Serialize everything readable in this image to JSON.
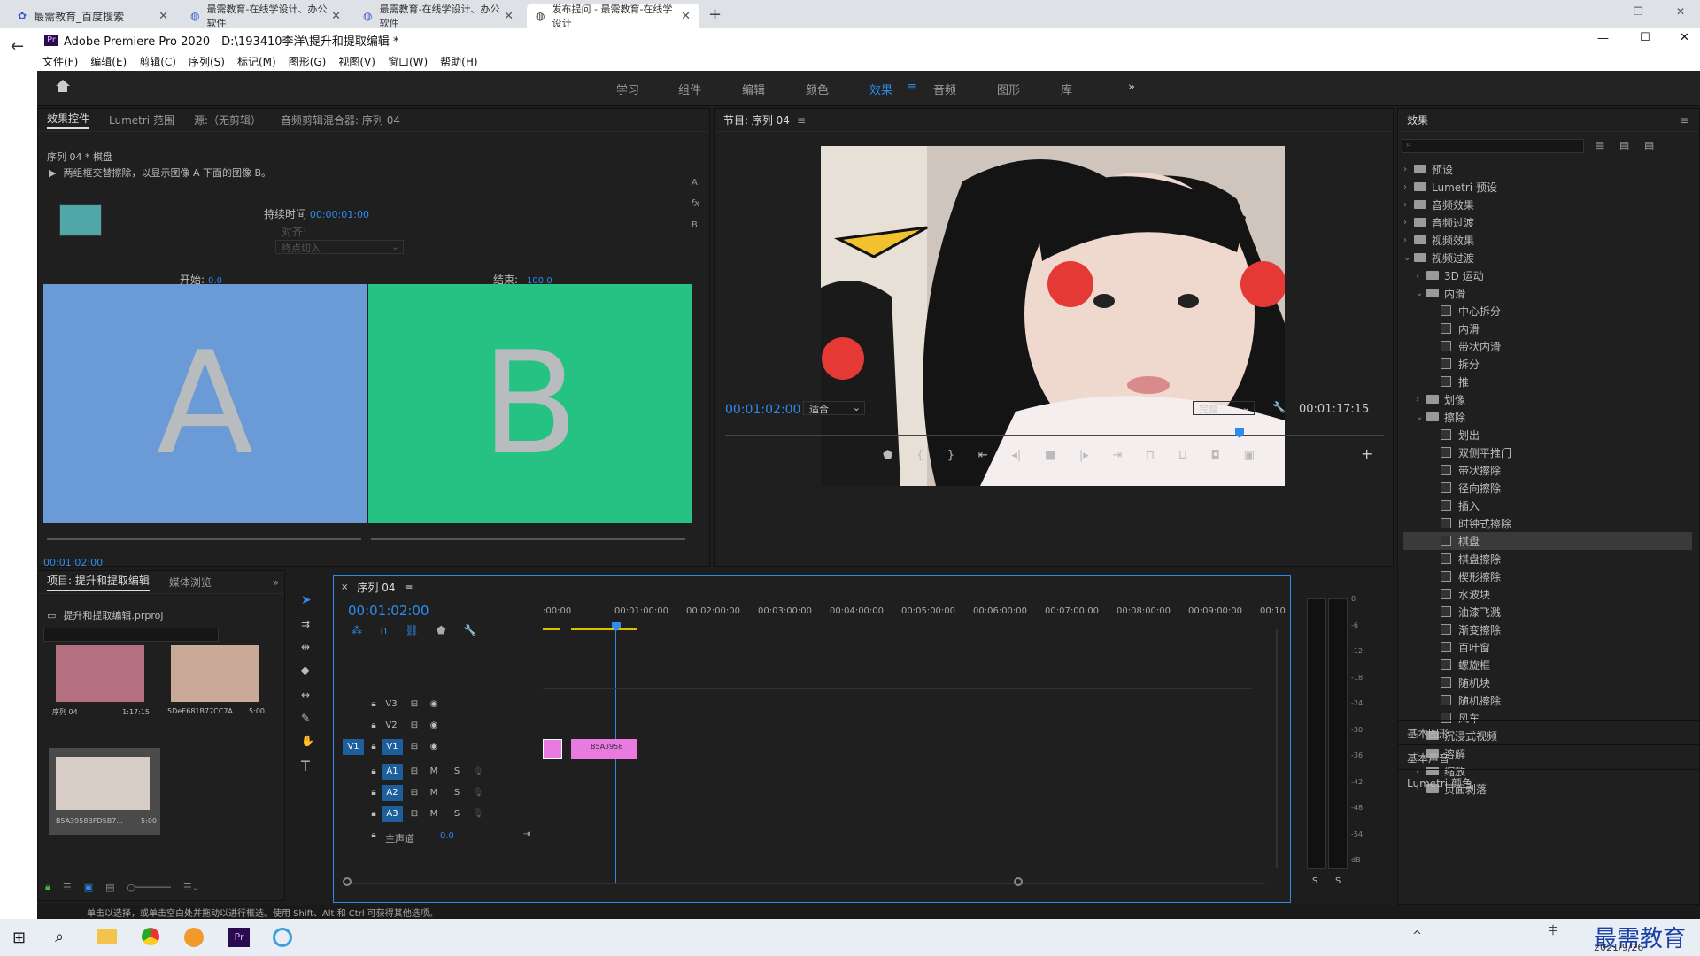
{
  "browser": {
    "tabs": [
      {
        "label": "最需教育_百度搜索",
        "icon": "paw-icon"
      },
      {
        "label": "最需教育-在线学设计、办公软件",
        "icon": "globe-icon"
      },
      {
        "label": "最需教育-在线学设计、办公软件",
        "icon": "globe-icon"
      },
      {
        "label": "发布提问 - 最需教育-在线学设计",
        "icon": "globe-icon"
      }
    ]
  },
  "app": {
    "title": "Adobe Premiere Pro 2020 - D:\\193410李洋\\提升和提取编辑 *",
    "logo": "Pr"
  },
  "menu": [
    "文件(F)",
    "编辑(E)",
    "剪辑(C)",
    "序列(S)",
    "标记(M)",
    "图形(G)",
    "视图(V)",
    "窗口(W)",
    "帮助(H)"
  ],
  "workspaces": [
    "学习",
    "组件",
    "编辑",
    "颜色",
    "效果",
    "音频",
    "图形",
    "库"
  ],
  "active_workspace": "效果",
  "ec": {
    "tabs": [
      "效果控件",
      "Lumetri 范围",
      "源:（无剪辑）",
      "音频剪辑混合器: 序列 04"
    ],
    "clip": "序列 04 * 棋盘",
    "desc": "两组框交替擦除，以显示图像 A 下面的图像 B。",
    "duration_label": "持续时间",
    "duration": "00:00:01:00",
    "align_label": "对齐:",
    "align_value": "终点切入",
    "start_label": "开始:",
    "start_val": "0.0",
    "end_label": "结束:",
    "end_val": "100.0",
    "a": "A",
    "b": "B",
    "sidebar": [
      "A",
      "fx",
      "B"
    ],
    "time": "00:01:02:00"
  },
  "program": {
    "title": "节目: 序列 04",
    "timecode": "00:01:02:00",
    "fit": "适合",
    "quality": "完整",
    "duration": "00:01:17:15"
  },
  "effects": {
    "title": "效果",
    "tree": [
      {
        "d": 0,
        "t": "folder",
        "label": "预设",
        "open": false
      },
      {
        "d": 0,
        "t": "folder",
        "label": "Lumetri 预设",
        "open": false
      },
      {
        "d": 0,
        "t": "folder",
        "label": "音频效果",
        "open": false
      },
      {
        "d": 0,
        "t": "folder",
        "label": "音频过渡",
        "open": false
      },
      {
        "d": 0,
        "t": "folder",
        "label": "视频效果",
        "open": false
      },
      {
        "d": 0,
        "t": "folder",
        "label": "视频过渡",
        "open": true
      },
      {
        "d": 1,
        "t": "folder",
        "label": "3D 运动",
        "open": false
      },
      {
        "d": 1,
        "t": "folder",
        "label": "内滑",
        "open": true
      },
      {
        "d": 2,
        "t": "fx",
        "label": "中心拆分"
      },
      {
        "d": 2,
        "t": "fx",
        "label": "内滑"
      },
      {
        "d": 2,
        "t": "fx",
        "label": "带状内滑"
      },
      {
        "d": 2,
        "t": "fx",
        "label": "拆分"
      },
      {
        "d": 2,
        "t": "fx",
        "label": "推"
      },
      {
        "d": 1,
        "t": "folder",
        "label": "划像",
        "open": false
      },
      {
        "d": 1,
        "t": "folder",
        "label": "擦除",
        "open": true
      },
      {
        "d": 2,
        "t": "fx",
        "label": "划出"
      },
      {
        "d": 2,
        "t": "fx",
        "label": "双侧平推门"
      },
      {
        "d": 2,
        "t": "fx",
        "label": "带状擦除"
      },
      {
        "d": 2,
        "t": "fx",
        "label": "径向擦除"
      },
      {
        "d": 2,
        "t": "fx",
        "label": "插入"
      },
      {
        "d": 2,
        "t": "fx",
        "label": "时钟式擦除"
      },
      {
        "d": 2,
        "t": "fx",
        "label": "棋盘",
        "selected": true
      },
      {
        "d": 2,
        "t": "fx",
        "label": "棋盘擦除"
      },
      {
        "d": 2,
        "t": "fx",
        "label": "楔形擦除"
      },
      {
        "d": 2,
        "t": "fx",
        "label": "水波块"
      },
      {
        "d": 2,
        "t": "fx",
        "label": "油漆飞溅"
      },
      {
        "d": 2,
        "t": "fx",
        "label": "渐变擦除"
      },
      {
        "d": 2,
        "t": "fx",
        "label": "百叶窗"
      },
      {
        "d": 2,
        "t": "fx",
        "label": "螺旋框"
      },
      {
        "d": 2,
        "t": "fx",
        "label": "随机块"
      },
      {
        "d": 2,
        "t": "fx",
        "label": "随机擦除"
      },
      {
        "d": 2,
        "t": "fx",
        "label": "风车"
      },
      {
        "d": 1,
        "t": "folder",
        "label": "沉浸式视频",
        "open": false
      },
      {
        "d": 1,
        "t": "folder",
        "label": "溶解",
        "open": false
      },
      {
        "d": 1,
        "t": "folder",
        "label": "缩放",
        "open": false
      },
      {
        "d": 1,
        "t": "folder",
        "label": "页面剥落",
        "open": false
      }
    ],
    "sections": [
      "基本图形",
      "基本声音",
      "Lumetri 颜色"
    ]
  },
  "project": {
    "tabs": [
      "项目: 提升和提取编辑",
      "媒体浏览"
    ],
    "file": "提升和提取编辑.prproj",
    "items": [
      {
        "name": "序列 04",
        "dur": "1:17:15"
      },
      {
        "name": "5DeE681B77CC7A...",
        "dur": "5:00"
      },
      {
        "name": "B5A3958BFD5B7...",
        "dur": "5:00"
      }
    ]
  },
  "timeline": {
    "title": "序列 04",
    "timecode": "00:01:02:00",
    "ruler": [
      ":00:00",
      "00:01:00:00",
      "00:02:00:00",
      "00:03:00:00",
      "00:04:00:00",
      "00:05:00:00",
      "00:06:00:00",
      "00:07:00:00",
      "00:08:00:00",
      "00:09:00:00",
      "00:10"
    ],
    "video_tracks": [
      "V3",
      "V2",
      "V1"
    ],
    "audio_tracks": [
      "A1",
      "A2",
      "A3"
    ],
    "master_label": "主声道",
    "master_val": "0.0",
    "source_patch": "V1",
    "clip_label": "B5A3958",
    "mute": "M",
    "solo": "S"
  },
  "meter": {
    "ticks": [
      "0",
      "-6",
      "-12",
      "-18",
      "-24",
      "-30",
      "-36",
      "-42",
      "-48",
      "-54",
      "dB"
    ],
    "s": "S"
  },
  "status": "单击以选择，或单击空白处并拖动以进行框选。使用 Shift、Alt 和 Ctrl 可获得其他选项。",
  "taskbar": {
    "date": "2021/9/26",
    "ime": "中",
    "watermark": "最需教育"
  }
}
